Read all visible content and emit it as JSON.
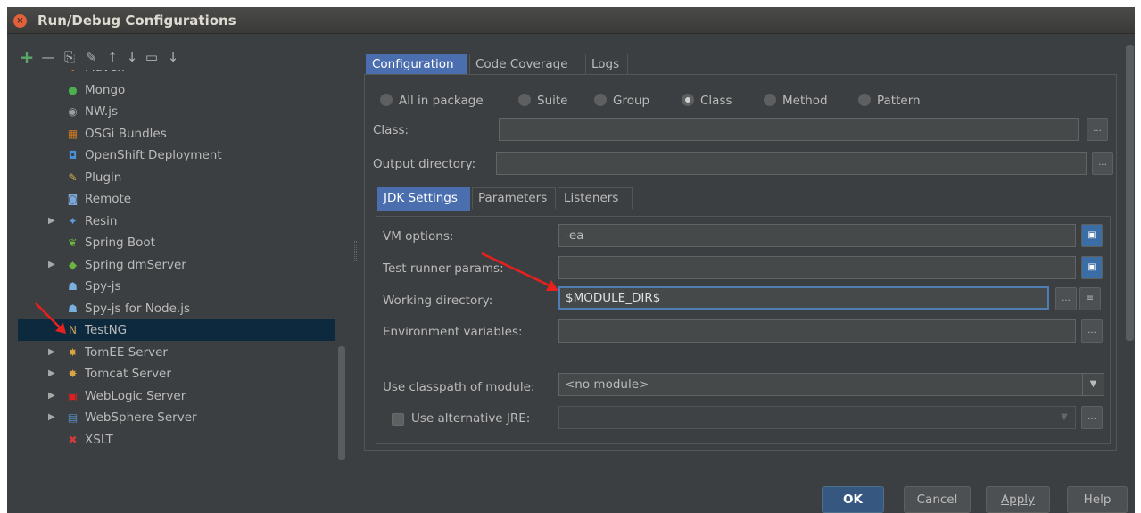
{
  "window": {
    "title": "Run/Debug Configurations",
    "close_glyph": "×"
  },
  "toolbar": {
    "icons": [
      "add-icon",
      "remove-icon",
      "copy-icon",
      "edit-defaults-icon",
      "move-up-icon",
      "move-down-icon",
      "folder-icon",
      "sort-icon"
    ],
    "glyphs": {
      "add": "+",
      "remove": "—",
      "copy": "⎘",
      "edit": "✎",
      "up": "↑",
      "down": "↓",
      "folder": "▭",
      "sort": "↓"
    }
  },
  "tree": {
    "items": [
      {
        "label": "Maven",
        "icon": "maven-icon",
        "expandable": false
      },
      {
        "label": "Mongo",
        "icon": "mongo-icon",
        "expandable": false
      },
      {
        "label": "NW.js",
        "icon": "nwjs-icon",
        "expandable": false
      },
      {
        "label": "OSGi Bundles",
        "icon": "osgi-icon",
        "expandable": false
      },
      {
        "label": "OpenShift Deployment",
        "icon": "openshift-icon",
        "expandable": false
      },
      {
        "label": "Plugin",
        "icon": "plugin-icon",
        "expandable": false
      },
      {
        "label": "Remote",
        "icon": "remote-icon",
        "expandable": false
      },
      {
        "label": "Resin",
        "icon": "resin-icon",
        "expandable": true
      },
      {
        "label": "Spring Boot",
        "icon": "spring-boot-icon",
        "expandable": false
      },
      {
        "label": "Spring dmServer",
        "icon": "spring-dmserver-icon",
        "expandable": true
      },
      {
        "label": "Spy-js",
        "icon": "spyjs-icon",
        "expandable": false
      },
      {
        "label": "Spy-js for Node.js",
        "icon": "spyjs-node-icon",
        "expandable": false
      },
      {
        "label": "TestNG",
        "icon": "testng-icon",
        "expandable": false,
        "selected": true
      },
      {
        "label": "TomEE Server",
        "icon": "tomee-icon",
        "expandable": true
      },
      {
        "label": "Tomcat Server",
        "icon": "tomcat-icon",
        "expandable": true
      },
      {
        "label": "WebLogic Server",
        "icon": "weblogic-icon",
        "expandable": true
      },
      {
        "label": "WebSphere Server",
        "icon": "websphere-icon",
        "expandable": true
      },
      {
        "label": "XSLT",
        "icon": "xslt-icon",
        "expandable": false
      }
    ],
    "expand_glyph": "▶"
  },
  "tabs": {
    "top": [
      "Configuration",
      "Code Coverage",
      "Logs"
    ],
    "inner": [
      "JDK Settings",
      "Parameters",
      "Listeners"
    ]
  },
  "test_kind": {
    "options": [
      "All in package",
      "Suite",
      "Group",
      "Class",
      "Method",
      "Pattern"
    ],
    "selected": "Class"
  },
  "form": {
    "class_label": "Class:",
    "class_value": "",
    "output_dir_label": "Output directory:",
    "output_dir_value": "",
    "vm_options_label": "VM options:",
    "vm_options_value": "-ea",
    "test_runner_params_label": "Test runner params:",
    "test_runner_params_value": "",
    "working_dir_label": "Working directory:",
    "working_dir_value": "$MODULE_DIR$",
    "env_vars_label": "Environment variables:",
    "env_vars_value": "",
    "classpath_label": "Use classpath of module:",
    "classpath_value": "<no module>",
    "alt_jre_label": "Use alternative JRE:",
    "alt_jre_value": "",
    "ellipsis": "...",
    "dropdown_glyph": "▼"
  },
  "footer": {
    "ok": "OK",
    "cancel": "Cancel",
    "apply": "Apply",
    "help": "Help"
  },
  "colors": {
    "bg": "#3c3f41",
    "accent": "#4b6eaf",
    "selection": "#0d293e",
    "arrow": "#e8201e"
  }
}
